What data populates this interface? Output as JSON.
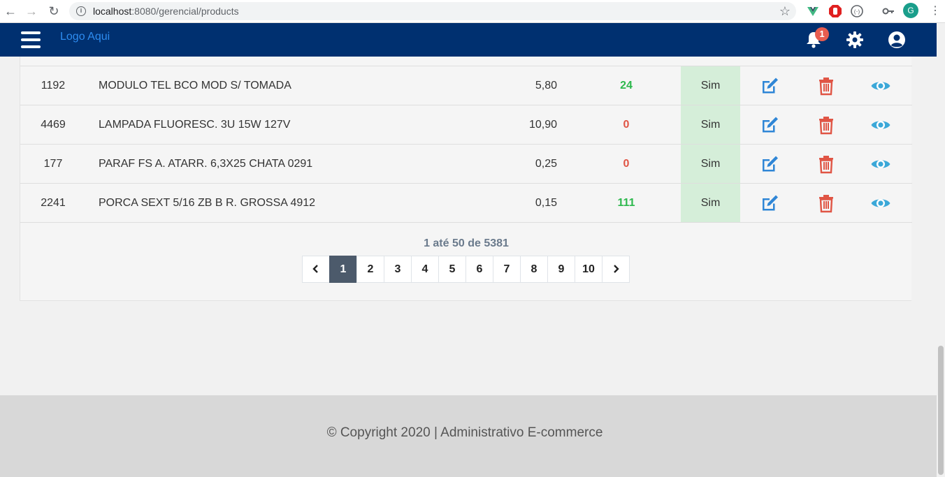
{
  "browser": {
    "url_host": "localhost",
    "url_path": ":8080/gerencial/products",
    "profile_initial": "G"
  },
  "header": {
    "logo_text": "Logo Aqui",
    "notification_count": "1",
    "brand_color": "#003070"
  },
  "products": [
    {
      "id": "1192",
      "name": "MODULO TEL BCO MOD S/ TOMADA",
      "price": "5,80",
      "stock": "24",
      "active": "Sim"
    },
    {
      "id": "4469",
      "name": "LAMPADA FLUORESC. 3U 15W  127V",
      "price": "10,90",
      "stock": "0",
      "active": "Sim"
    },
    {
      "id": "177",
      "name": "PARAF FS A. ATARR. 6,3X25 CHATA  0291",
      "price": "0,25",
      "stock": "0",
      "active": "Sim"
    },
    {
      "id": "2241",
      "name": "PORCA SEXT 5/16 ZB B R. GROSSA 4912",
      "price": "0,15",
      "stock": "111",
      "active": "Sim"
    }
  ],
  "pagination": {
    "summary": "1 até 50 de 5381",
    "pages": [
      "1",
      "2",
      "3",
      "4",
      "5",
      "6",
      "7",
      "8",
      "9",
      "10"
    ],
    "current": "1"
  },
  "footer": {
    "text": "© Copyright 2020 | Administrativo E-commerce"
  },
  "icons": {
    "edit": "edit-icon",
    "delete": "trash-icon",
    "view": "eye-icon"
  },
  "colors": {
    "stock_positive": "#2db84d",
    "stock_zero": "#e05545",
    "edit": "#2f86d6",
    "delete": "#e05545",
    "view": "#3ba8d8"
  }
}
